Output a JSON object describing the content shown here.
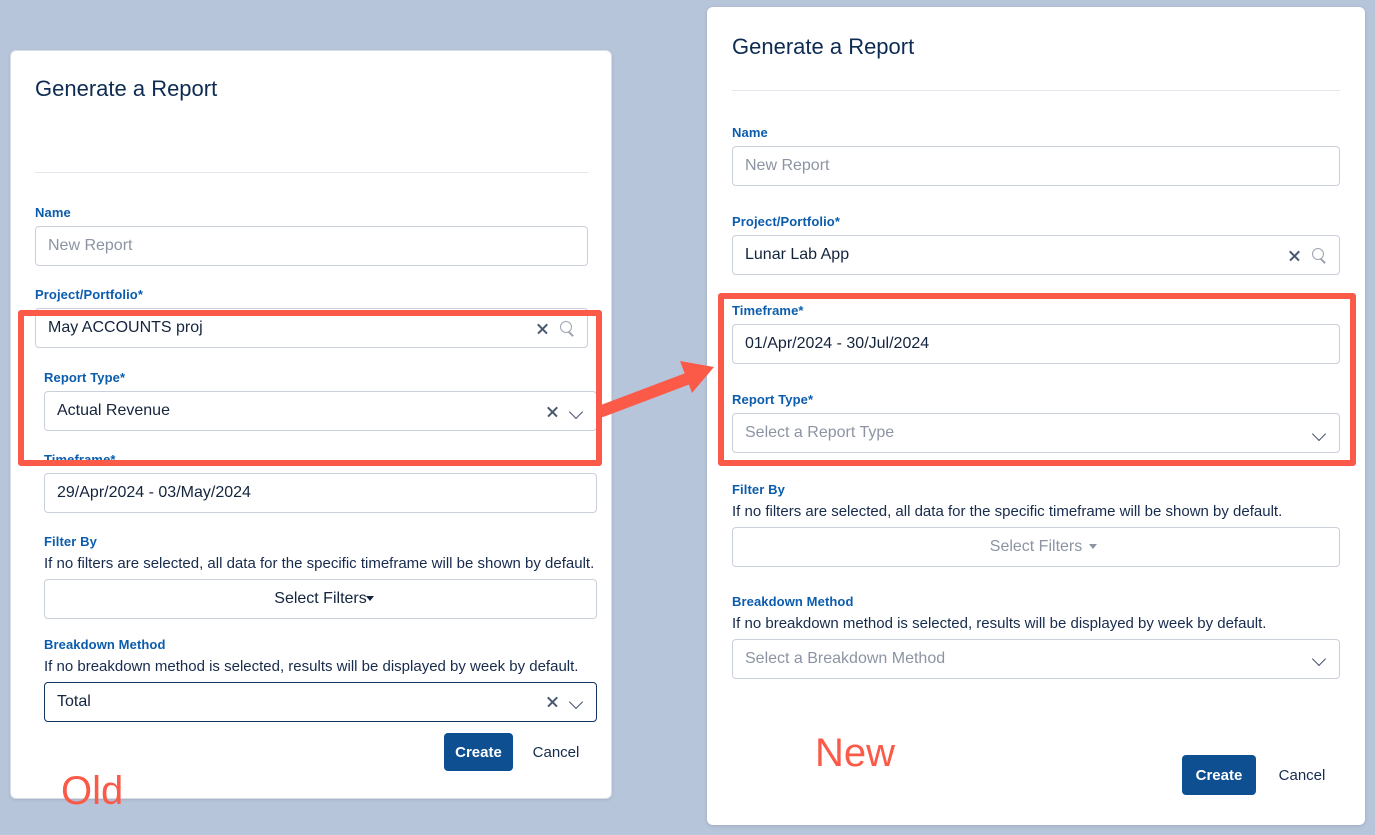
{
  "background_color": "#b7c5da",
  "accent_color": "#fb5a49",
  "primary_button_color": "#0e4f91",
  "label_color": "#0b5cad",
  "annotations": {
    "old_tag": "Old",
    "new_tag": "New",
    "arrow": "right-arrow"
  },
  "old_panel": {
    "title": "Generate a Report",
    "fields": {
      "name": {
        "label": "Name",
        "value": "",
        "placeholder": "New Report"
      },
      "project": {
        "label": "Project/Portfolio*",
        "value": "May ACCOUNTS proj",
        "icons": [
          "clear-icon",
          "search-icon"
        ]
      },
      "report_type": {
        "label": "Report Type*",
        "value": "Actual Revenue",
        "icons": [
          "clear-icon",
          "chevron-down-icon"
        ]
      },
      "timeframe": {
        "label": "Timeframe*",
        "value": "29/Apr/2024 - 03/May/2024"
      },
      "filter_by": {
        "label": "Filter By",
        "help": "If no filters are selected, all data for the specific timeframe will be shown by default.",
        "value": "Select Filters"
      },
      "breakdown_method": {
        "label": "Breakdown Method",
        "help": "If no breakdown method is selected, results will be displayed by week by default.",
        "value": "Total",
        "icons": [
          "clear-icon",
          "chevron-down-icon"
        ]
      }
    },
    "footer": {
      "create_label": "Create",
      "cancel_label": "Cancel"
    }
  },
  "new_panel": {
    "title": "Generate a Report",
    "fields": {
      "name": {
        "label": "Name",
        "value": "",
        "placeholder": "New Report"
      },
      "project": {
        "label": "Project/Portfolio*",
        "value": "Lunar Lab App",
        "icons": [
          "clear-icon",
          "search-icon"
        ]
      },
      "timeframe": {
        "label": "Timeframe*",
        "value": "01/Apr/2024 - 30/Jul/2024"
      },
      "report_type": {
        "label": "Report Type*",
        "value": "",
        "placeholder": "Select a Report Type",
        "icons": [
          "chevron-down-icon"
        ]
      },
      "filter_by": {
        "label": "Filter By",
        "help": "If no filters are selected, all data for the specific timeframe will be shown by default.",
        "value": "Select Filters"
      },
      "breakdown_method": {
        "label": "Breakdown Method",
        "help": "If no breakdown method is selected, results will be displayed by week by default.",
        "value": "",
        "placeholder": "Select a Breakdown Method",
        "icons": [
          "chevron-down-icon"
        ]
      }
    },
    "footer": {
      "create_label": "Create",
      "cancel_label": "Cancel"
    }
  }
}
